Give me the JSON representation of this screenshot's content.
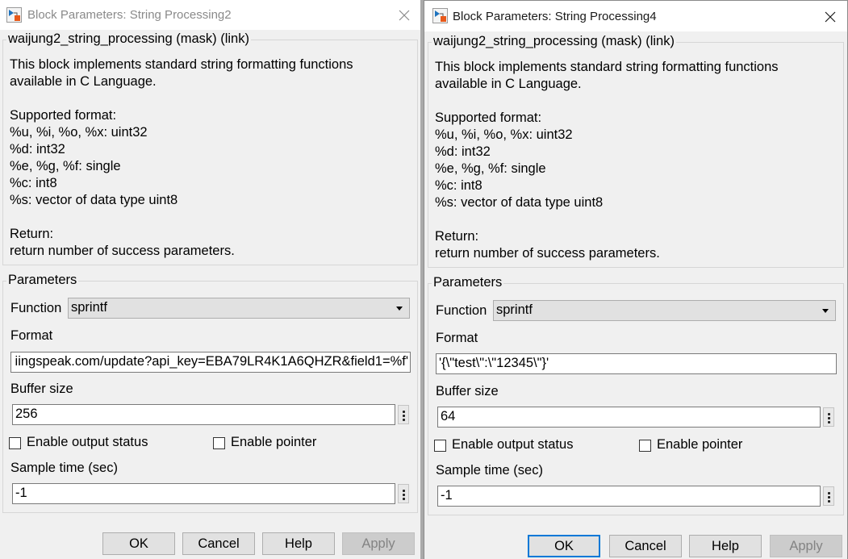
{
  "dialogs": [
    {
      "title": "Block Parameters: String Processing2",
      "active": false,
      "mask_title": "waijung2_string_processing (mask) (link)",
      "description": [
        "This block implements standard string formatting functions",
        "available in C Language.",
        "",
        "Supported format:",
        "%u, %i, %o, %x: uint32",
        "%d: int32",
        "%e, %g, %f: single",
        "%c: int8",
        "%s: vector of data type uint8",
        "",
        "Return:",
        "return number of success parameters."
      ],
      "parameters_label": "Parameters",
      "function_label": "Function",
      "function_value": "sprintf",
      "format_label": "Format",
      "format_value": "iingspeak.com/update?api_key=EBA79LR4K1A6QHZR&field1=%f'",
      "buffer_label": "Buffer size",
      "buffer_value": "256",
      "enable_output_status_label": "Enable output status",
      "enable_output_status_checked": false,
      "enable_pointer_label": "Enable pointer",
      "enable_pointer_checked": false,
      "sample_time_label": "Sample time (sec)",
      "sample_time_value": "-1",
      "buttons": {
        "ok": "OK",
        "cancel": "Cancel",
        "help": "Help",
        "apply": "Apply"
      }
    },
    {
      "title": "Block Parameters: String Processing4",
      "active": true,
      "mask_title": "waijung2_string_processing (mask) (link)",
      "description": [
        "This block implements standard string formatting functions",
        "available in C Language.",
        "",
        "Supported format:",
        "%u, %i, %o, %x: uint32",
        "%d: int32",
        "%e, %g, %f: single",
        "%c: int8",
        "%s: vector of data type uint8",
        "",
        "Return:",
        "return number of success parameters."
      ],
      "parameters_label": "Parameters",
      "function_label": "Function",
      "function_value": "sprintf",
      "format_label": "Format",
      "format_value": "'{\\\"test\\\":\\\"12345\\\"}'",
      "buffer_label": "Buffer size",
      "buffer_value": "64",
      "enable_output_status_label": "Enable output status",
      "enable_output_status_checked": false,
      "enable_pointer_label": "Enable pointer",
      "enable_pointer_checked": false,
      "sample_time_label": "Sample time (sec)",
      "sample_time_value": "-1",
      "buttons": {
        "ok": "OK",
        "cancel": "Cancel",
        "help": "Help",
        "apply": "Apply"
      }
    }
  ],
  "colors": {
    "accent": "#0078d7",
    "icon_blue": "#1e73be",
    "icon_orange": "#e8591a"
  }
}
